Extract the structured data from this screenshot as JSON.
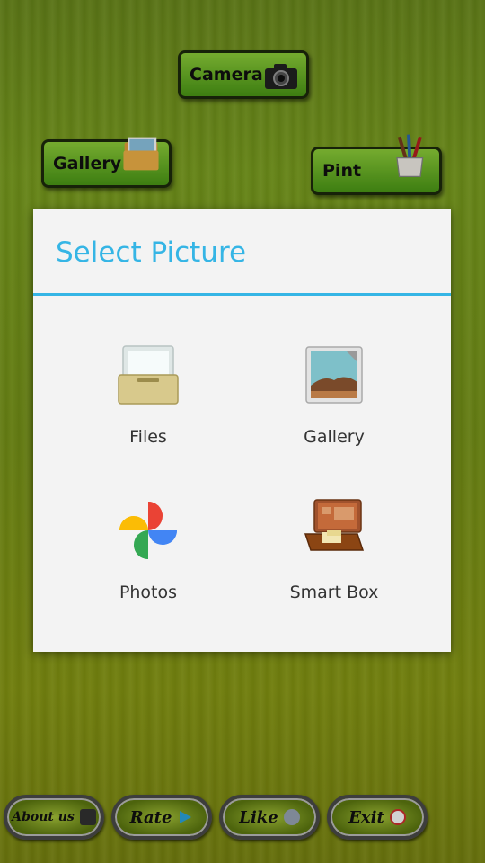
{
  "background_app": {
    "camera_button": {
      "label": "Camera",
      "icon": "camera-icon"
    },
    "gallery_button": {
      "label": "Gallery",
      "icon": "photo-folder-icon"
    },
    "paint_button": {
      "label": "Pint",
      "icon": "paint-brushes-cup-icon"
    },
    "bottom_bar": [
      {
        "label": "About us",
        "icon": "image-icon"
      },
      {
        "label": "Rate",
        "icon": "play-store-icon"
      },
      {
        "label": "Like",
        "icon": "thumbs-up-icon"
      },
      {
        "label": "Exit",
        "icon": "power-icon"
      }
    ]
  },
  "dialog": {
    "title": "Select Picture",
    "accent_color": "#35b5e5",
    "options": [
      {
        "label": "Files",
        "icon": "file-drawer-icon"
      },
      {
        "label": "Gallery",
        "icon": "landscape-photo-icon"
      },
      {
        "label": "Photos",
        "icon": "google-photos-pinwheel-icon"
      },
      {
        "label": "Smart Box",
        "icon": "briefcase-icon"
      }
    ]
  }
}
